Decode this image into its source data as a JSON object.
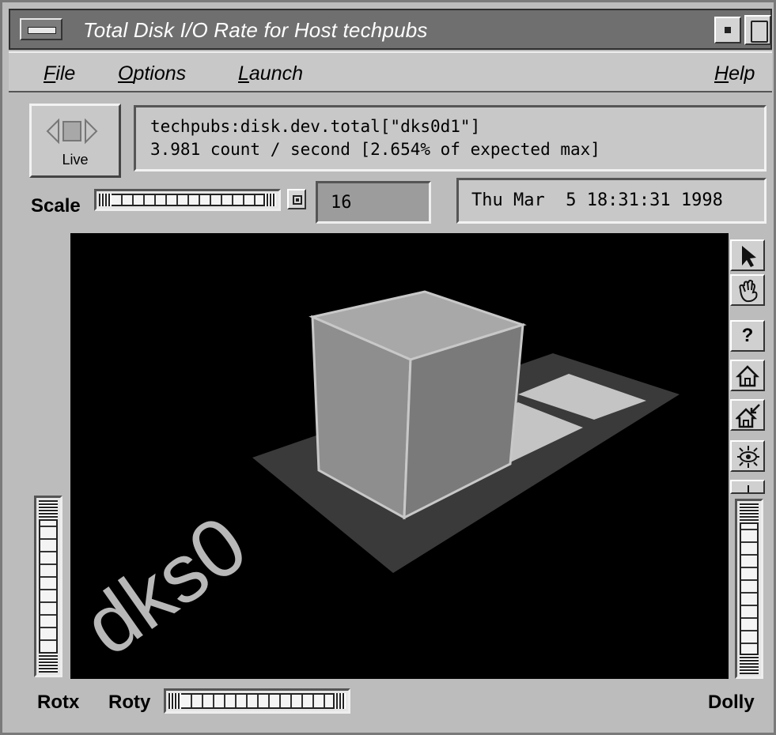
{
  "window": {
    "title": "Total Disk I/O Rate for Host techpubs"
  },
  "menubar": {
    "file": "ile",
    "file_mnemonic": "F",
    "options": "ptions",
    "options_mnemonic": "O",
    "launch": "aunch",
    "launch_mnemonic": "L",
    "help": "elp",
    "help_mnemonic": "H"
  },
  "live_button": {
    "label": "Live"
  },
  "info": {
    "metric": "techpubs:disk.dev.total[\"dks0d1\"]",
    "value": "3.981 count / second [2.654% of expected max]"
  },
  "scale": {
    "label": "Scale",
    "value": "16"
  },
  "timestamp": "Thu Mar  5 18:31:31 1998",
  "scene": {
    "disk_label": "dks0",
    "colors": {
      "background": "#000000",
      "cube_front": "#8e8e8e",
      "cube_side": "#7a7a7a",
      "cube_top": "#a4a4a4",
      "base": "#3a3a3a",
      "text": "#b8b8b8"
    }
  },
  "viewer_tools": [
    {
      "icon": "pointer-arrow-icon"
    },
    {
      "icon": "hand-icon"
    },
    {
      "icon": "question-icon",
      "glyph": "?"
    },
    {
      "icon": "home-icon"
    },
    {
      "icon": "set-home-icon"
    },
    {
      "icon": "view-all-icon"
    },
    {
      "icon": "seek-icon"
    }
  ],
  "bottom": {
    "rotx": "Rotx",
    "roty": "Roty",
    "dolly": "Dolly"
  }
}
